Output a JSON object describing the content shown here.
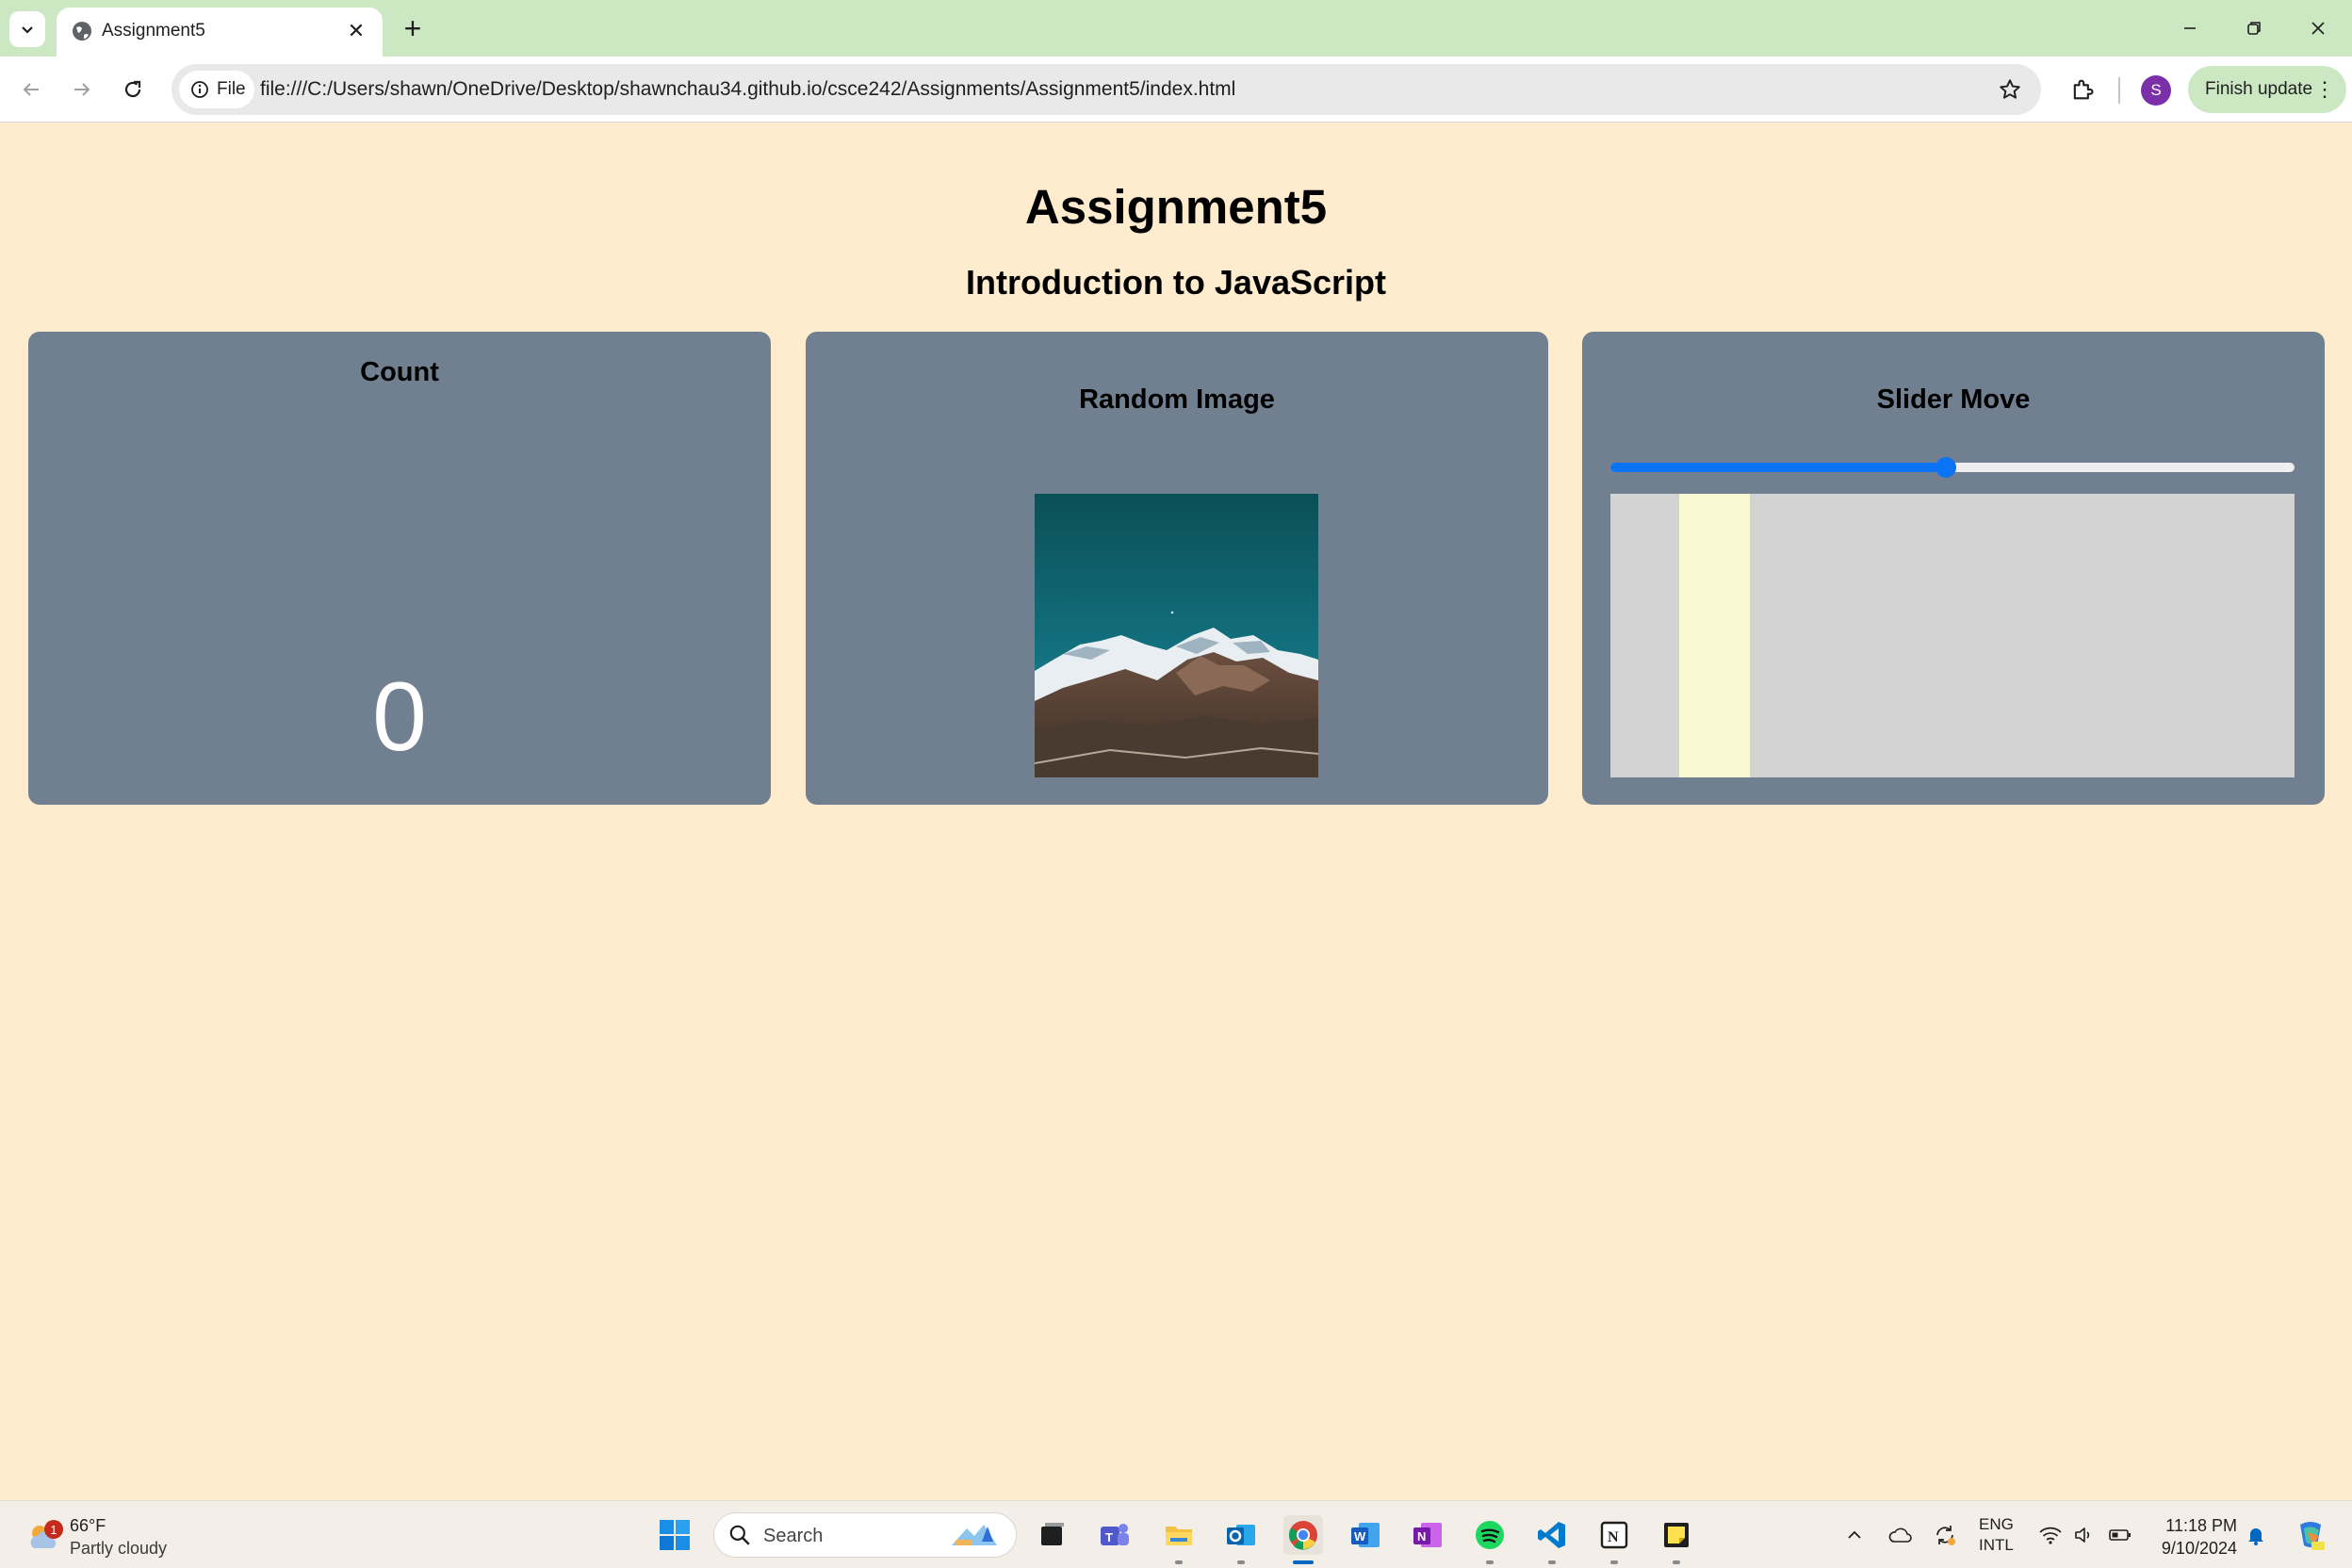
{
  "browser": {
    "tab_title": "Assignment5",
    "tab_close_glyph": "✕",
    "new_tab_glyph": "+",
    "address_chip_label": "File",
    "url": "file:///C:/Users/shawn/OneDrive/Desktop/shawnchau34.github.io/csce242/Assignments/Assignment5/index.html",
    "profile_initial": "S",
    "finish_update_label": "Finish update",
    "menu_glyph": "⋮"
  },
  "page": {
    "title": "Assignment5",
    "subtitle": "Introduction to JavaScript",
    "cards": {
      "count": {
        "title": "Count",
        "value": "0"
      },
      "random_image": {
        "title": "Random Image",
        "image": "mountain-landscape"
      },
      "slider": {
        "title": "Slider Move",
        "slider_value_percent": 49,
        "block_position_fraction": 0.1
      }
    }
  },
  "colors": {
    "page_background": "#ffebcd",
    "card_background": "#708090",
    "slider_accent": "#0b73f4",
    "slider_box": "#d3d3d3",
    "slider_block": "#fafad2",
    "title_bar": "#cbe8c3"
  },
  "taskbar": {
    "weather": {
      "temp": "66°F",
      "desc": "Partly cloudy",
      "badge": "1"
    },
    "search_placeholder": "Search",
    "apps": [
      "windows-start",
      "copilot",
      "task-view",
      "teams",
      "file-explorer",
      "outlook",
      "chrome",
      "word",
      "onenote",
      "spotify",
      "vscode",
      "notion",
      "sticky-notes"
    ],
    "tray": {
      "lang_line1": "ENG",
      "lang_line2": "INTL",
      "time": "11:18 PM",
      "date": "9/10/2024"
    }
  }
}
